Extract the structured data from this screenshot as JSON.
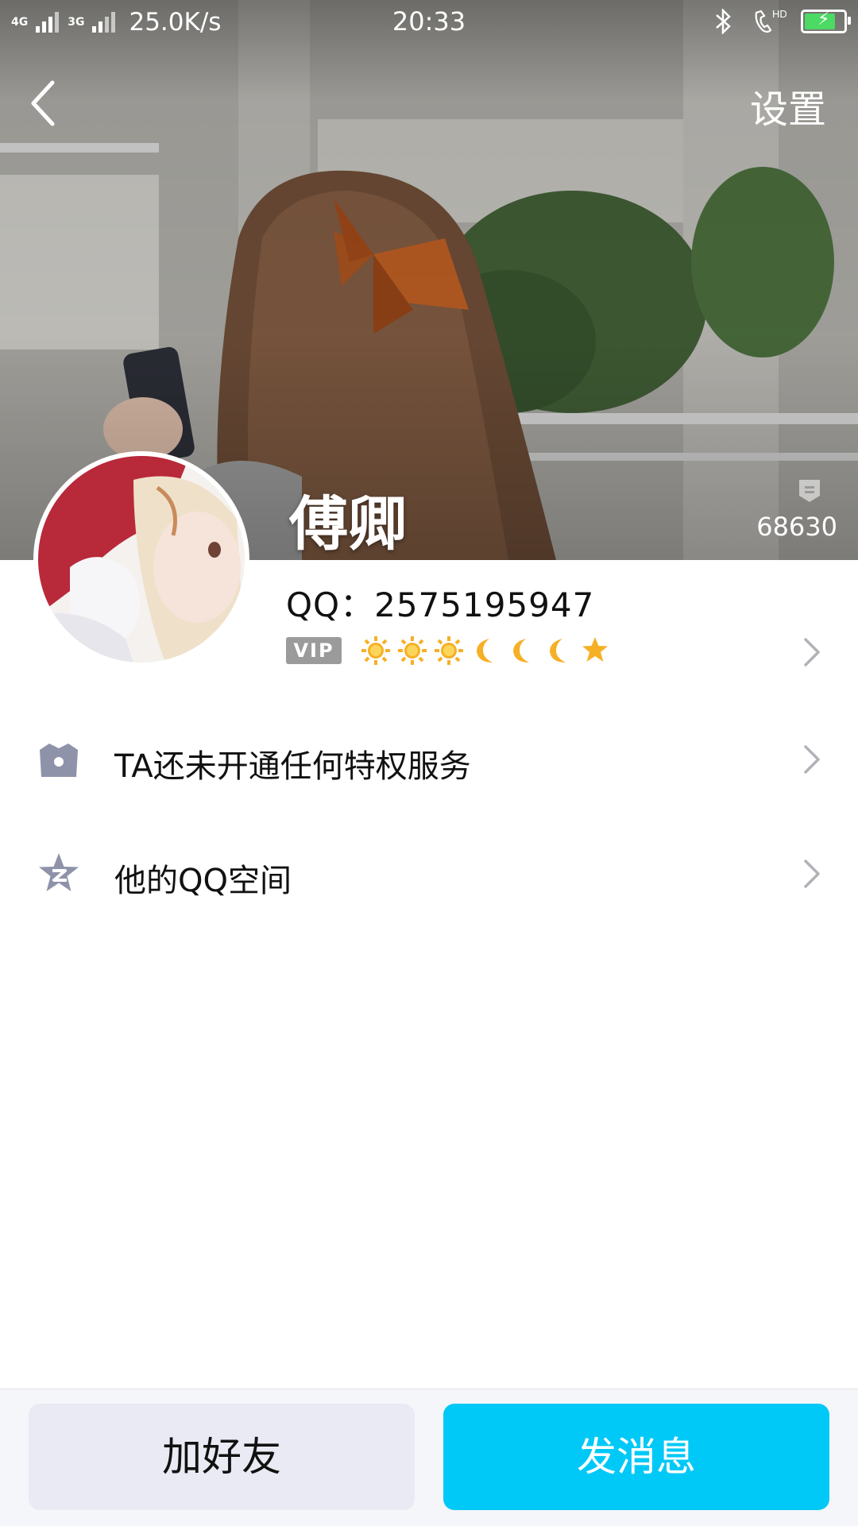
{
  "status_bar": {
    "network_1": "4G",
    "network_2": "3G",
    "speed": "25.0K/s",
    "time": "20:33",
    "hd_label": "HD"
  },
  "nav": {
    "settings_label": "设置"
  },
  "profile": {
    "nickname": "傅卿",
    "qq_text": "QQ：2575195947",
    "likes_count": "68630",
    "vip_label": "VIP",
    "level_icons": [
      "sun",
      "sun",
      "sun",
      "moon",
      "moon",
      "moon",
      "star"
    ]
  },
  "list": {
    "privilege_label": "TA还未开通任何特权服务",
    "qzone_label": "他的QQ空间"
  },
  "actions": {
    "add_friend_label": "加好友",
    "send_message_label": "发消息"
  },
  "colors": {
    "primary_button": "#00c9f7",
    "secondary_button": "#e9eaf3",
    "icon_gray": "#8e93aa"
  }
}
